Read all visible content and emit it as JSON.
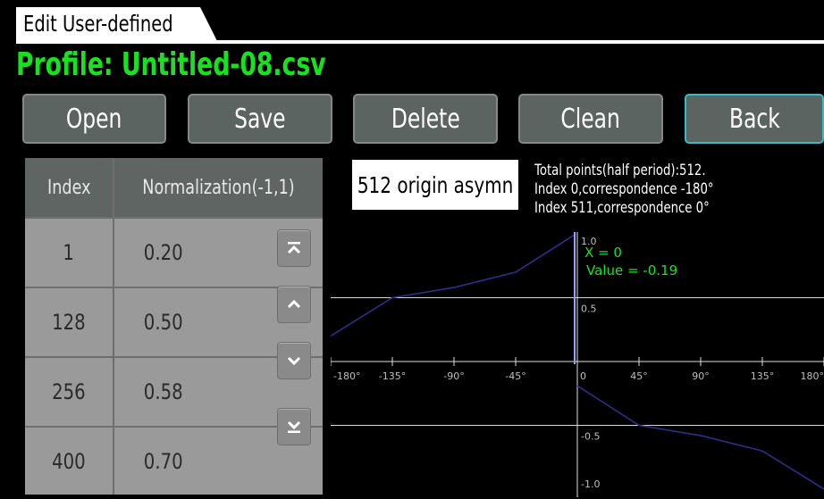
{
  "tab": {
    "label": "Edit User-defined"
  },
  "profile": {
    "text": "Profile: Untitled-08.csv"
  },
  "toolbar": {
    "open": "Open",
    "save": "Save",
    "delete": "Delete",
    "clean": "Clean",
    "back": "Back"
  },
  "table": {
    "headers": [
      "Index",
      "Normalization(-1,1)"
    ],
    "rows": [
      {
        "index": "1",
        "value": "0.20"
      },
      {
        "index": "128",
        "value": "0.50"
      },
      {
        "index": "256",
        "value": "0.58"
      },
      {
        "index": "400",
        "value": "0.70"
      }
    ],
    "scroll_buttons": [
      "scroll-top",
      "scroll-up",
      "scroll-down",
      "scroll-bottom"
    ]
  },
  "waveform": {
    "name": "512 origin asymn"
  },
  "info": {
    "line1": "Total points(half period):512.",
    "line2": "Index 0,correspondence -180°",
    "line3": "Index 511,correspondence 0°"
  },
  "cursor": {
    "x_text": "X = 0",
    "value_text": "Value = -0.19",
    "x": 0,
    "value": -0.19
  },
  "colors": {
    "accent_green": "#18e21e",
    "curve": "#2c2f8a",
    "cursor_line": "#8fa6ff",
    "back_border": "#3ab9c9"
  },
  "chart_data": {
    "type": "line",
    "xlabel": "",
    "ylabel": "",
    "x_ticks": [
      "-180°",
      "-135°",
      "-90°",
      "-45°",
      "0",
      "45°",
      "90°",
      "135°",
      "180°"
    ],
    "y_ticks": [
      "1.0",
      "0.5",
      "-0.5",
      "-1.0"
    ],
    "xlim": [
      -180,
      180
    ],
    "ylim": [
      -1.0,
      1.0
    ],
    "series": [
      {
        "x": [
          -180,
          -135,
          -90,
          -45,
          -1,
          0,
          45,
          90,
          135,
          180
        ],
        "y": [
          0.2,
          0.5,
          0.58,
          0.7,
          1.0,
          -0.19,
          -0.5,
          -0.58,
          -0.7,
          -1.0
        ]
      }
    ],
    "grid": true
  }
}
